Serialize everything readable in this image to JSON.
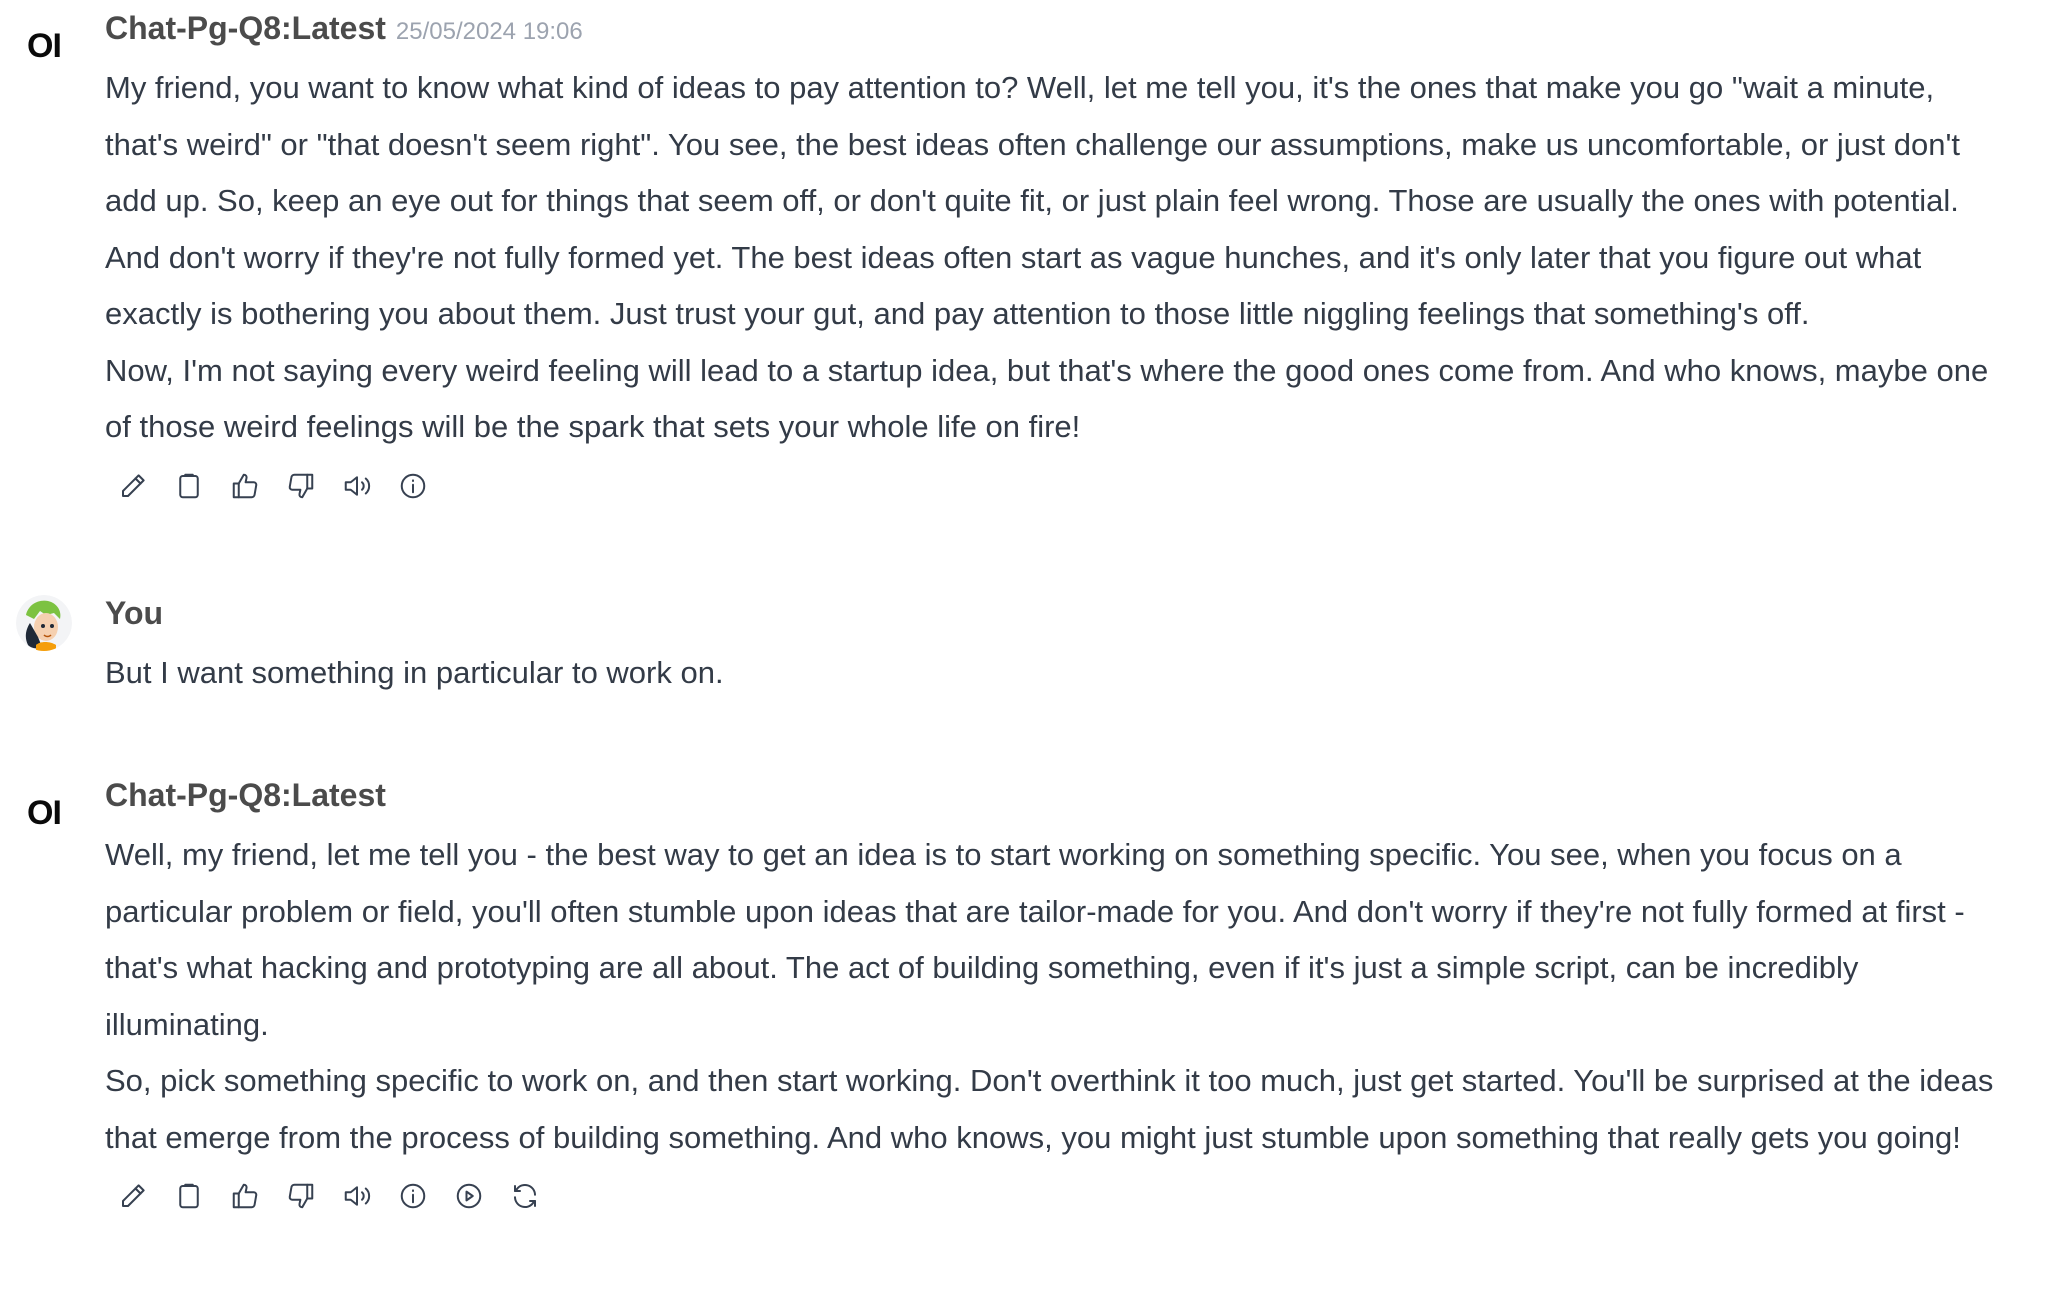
{
  "messages": [
    {
      "role": "assistant",
      "avatar_text": "OI",
      "name": "Chat-Pg-Q8:Latest",
      "timestamp": "25/05/2024 19:06",
      "paragraphs": [
        "My friend, you want to know what kind of ideas to pay attention to? Well, let me tell you, it's the ones that make you go \"wait a minute, that's weird\" or \"that doesn't seem right\". You see, the best ideas often challenge our assumptions, make us uncomfortable, or just don't add up. So, keep an eye out for things that seem off, or don't quite fit, or just plain feel wrong. Those are usually the ones with potential.",
        "And don't worry if they're not fully formed yet. The best ideas often start as vague hunches, and it's only later that you figure out what exactly is bothering you about them. Just trust your gut, and pay attention to those little niggling feelings that something's off.",
        "Now, I'm not saying every weird feeling will lead to a startup idea, but that's where the good ones come from. And who knows, maybe one of those weird feelings will be the spark that sets your whole life on fire!"
      ],
      "actions": [
        "edit-icon",
        "copy-icon",
        "thumbs-up-icon",
        "thumbs-down-icon",
        "read-aloud-icon",
        "info-icon"
      ]
    },
    {
      "role": "user",
      "name": "You",
      "paragraphs": [
        "But I want something in particular to work on."
      ]
    },
    {
      "role": "assistant",
      "avatar_text": "OI",
      "name": "Chat-Pg-Q8:Latest",
      "paragraphs": [
        "Well, my friend, let me tell you - the best way to get an idea is to start working on something specific. You see, when you focus on a particular problem or field, you'll often stumble upon ideas that are tailor-made for you. And don't worry if they're not fully formed at first - that's what hacking and prototyping are all about. The act of building something, even if it's just a simple script, can be incredibly illuminating.",
        "So, pick something specific to work on, and then start working. Don't overthink it too much, just get started. You'll be surprised at the ideas that emerge from the process of building something. And who knows, you might just stumble upon something that really gets you going!"
      ],
      "actions": [
        "edit-icon",
        "copy-icon",
        "thumbs-up-icon",
        "thumbs-down-icon",
        "read-aloud-icon",
        "info-icon",
        "continue-icon",
        "regenerate-icon"
      ]
    }
  ]
}
